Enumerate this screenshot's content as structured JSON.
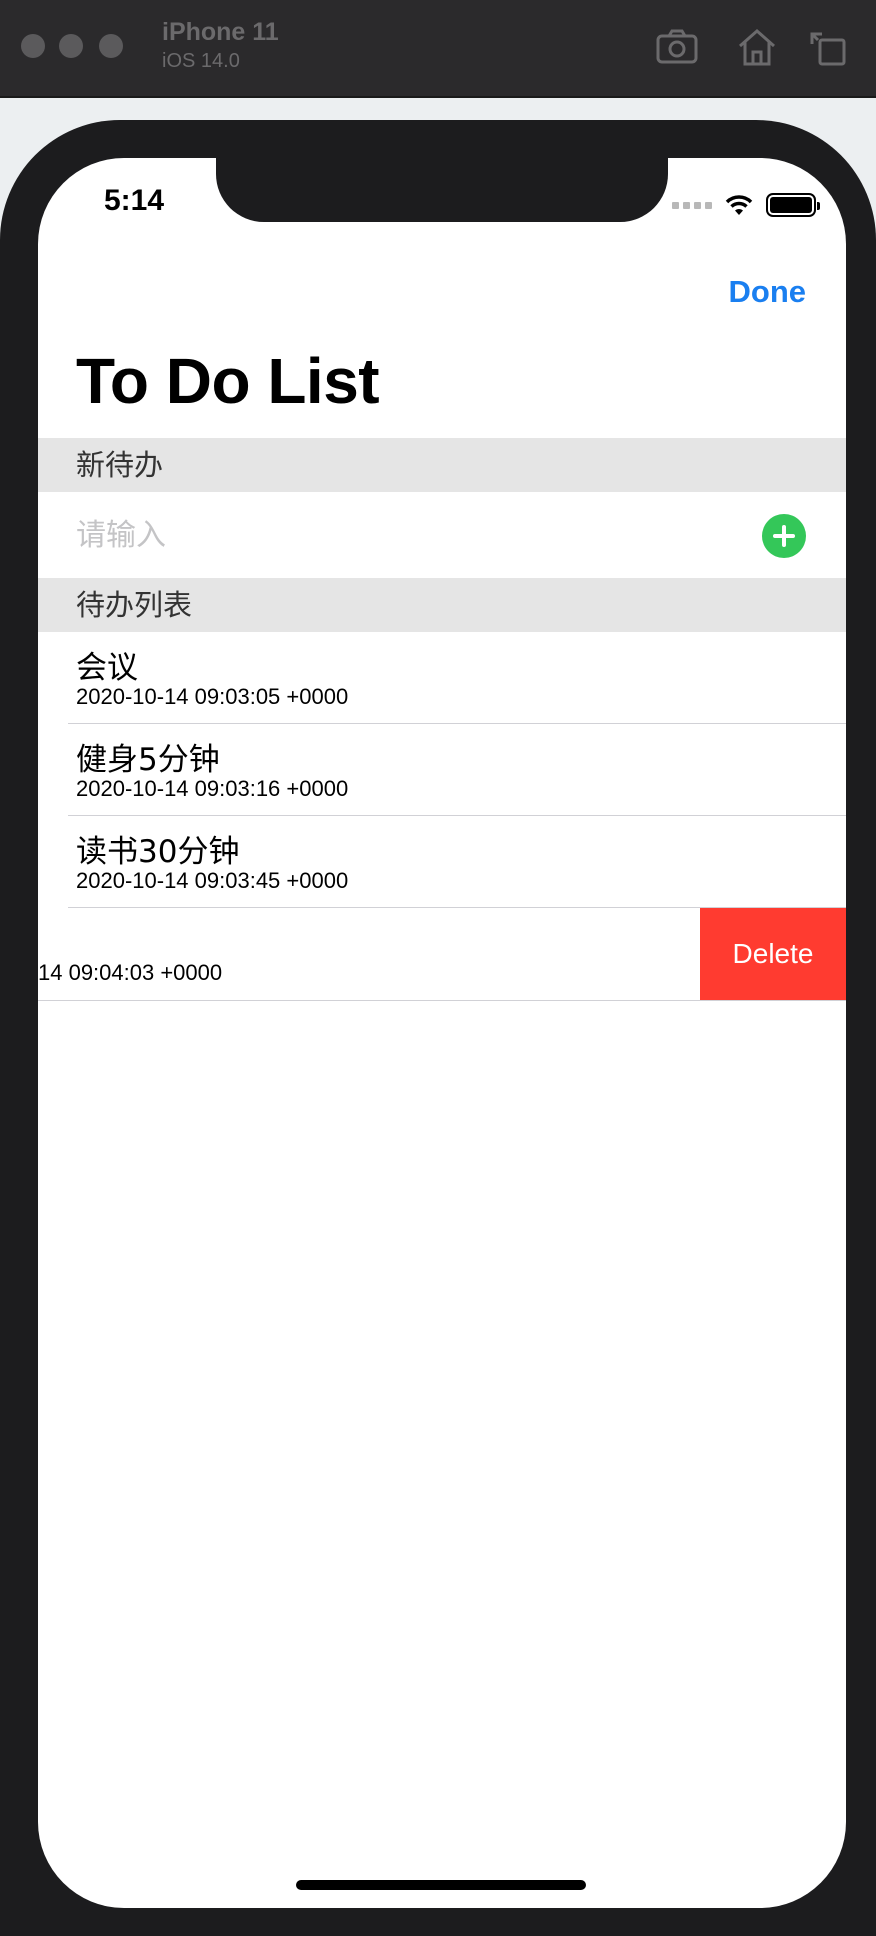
{
  "simulator": {
    "device_name": "iPhone 11",
    "os_version": "iOS 14.0",
    "icons": [
      "screenshot-icon",
      "home-icon",
      "rotate-icon"
    ]
  },
  "status_bar": {
    "time": "5:14"
  },
  "nav": {
    "done_label": "Done",
    "title": "To Do List"
  },
  "new_section": {
    "header": "新待办",
    "input_placeholder": "请输入",
    "input_value": ""
  },
  "list_section": {
    "header": "待办列表",
    "items": [
      {
        "title": "会议",
        "date": "2020-10-14 09:03:05 +0000"
      },
      {
        "title": "健身5分钟",
        "date": "2020-10-14 09:03:16 +0000"
      },
      {
        "title": "读书30分钟",
        "date": "2020-10-14 09:03:45 +0000"
      }
    ],
    "swiped_item": {
      "visible_date": "14 09:04:03 +0000",
      "delete_label": "Delete"
    }
  },
  "colors": {
    "tint_blue": "#1a7ff0",
    "add_green": "#34c759",
    "delete_red": "#ff3b30",
    "section_gray": "#e5e5e5"
  }
}
